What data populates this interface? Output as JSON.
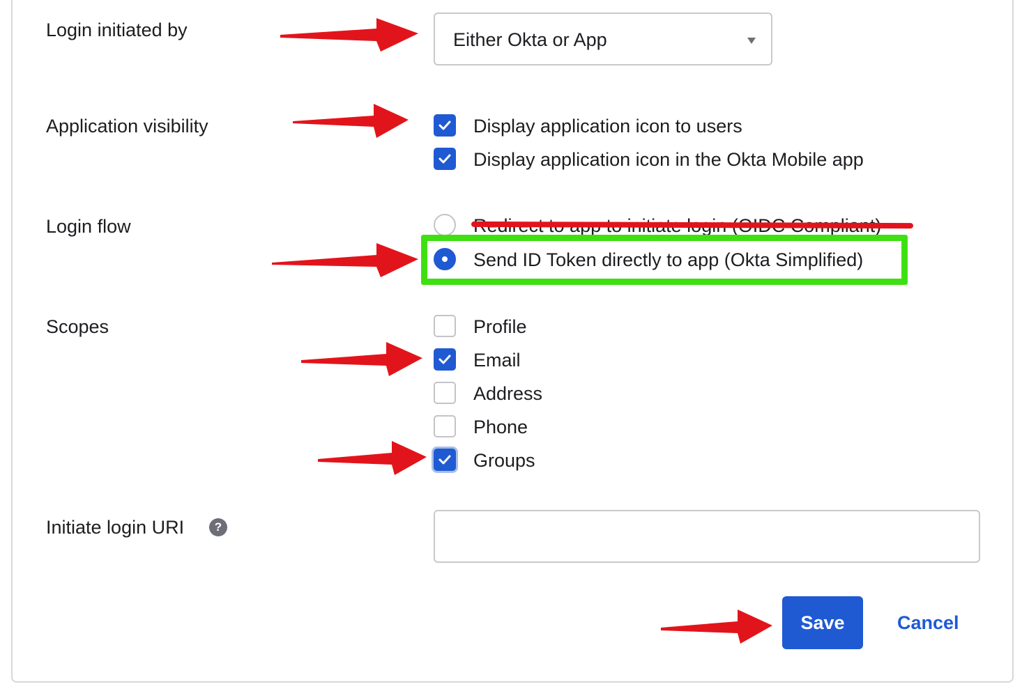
{
  "form": {
    "login_initiated_by": {
      "label": "Login initiated by",
      "selected": "Either Okta or App"
    },
    "application_visibility": {
      "label": "Application visibility",
      "options": [
        {
          "label": "Display application icon to users",
          "checked": true
        },
        {
          "label": "Display application icon in the Okta Mobile app",
          "checked": true
        }
      ]
    },
    "login_flow": {
      "label": "Login flow",
      "options": [
        {
          "label": "Redirect to app to initiate login (OIDC Compliant)",
          "selected": false,
          "struck_out": true
        },
        {
          "label": "Send ID Token directly to app (Okta Simplified)",
          "selected": true
        }
      ]
    },
    "scopes": {
      "label": "Scopes",
      "options": [
        {
          "label": "Profile",
          "checked": false
        },
        {
          "label": "Email",
          "checked": true
        },
        {
          "label": "Address",
          "checked": false
        },
        {
          "label": "Phone",
          "checked": false
        },
        {
          "label": "Groups",
          "checked": true
        }
      ]
    },
    "initiate_login_uri": {
      "label": "Initiate login URI",
      "value": ""
    },
    "help_icon_glyph": "?",
    "actions": {
      "save": "Save",
      "cancel": "Cancel"
    }
  },
  "colors": {
    "primary": "#1f5ad3",
    "annotation_arrow": "#e2141b",
    "highlight_box": "#3fe012"
  },
  "icons": [
    "chevron-down-icon",
    "checkmark-icon",
    "help-icon",
    "annotation-arrow-icon"
  ]
}
